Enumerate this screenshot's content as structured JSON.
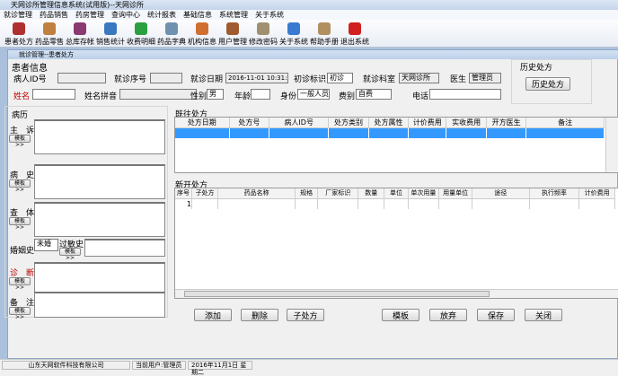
{
  "window": {
    "title": "天网诊所管理信息系统(试用版)--天网诊所"
  },
  "menu": [
    "就诊管理",
    "药品销售",
    "药房管理",
    "查询中心",
    "统计报表",
    "基础信息",
    "系统管理",
    "关于系统"
  ],
  "toolbar": [
    {
      "label": "患者处方",
      "icon": "patient-prescription-icon",
      "color": "#b03030"
    },
    {
      "label": "药品零售",
      "icon": "drug-retail-icon",
      "color": "#c08040"
    },
    {
      "label": "总库存帐",
      "icon": "inventory-icon",
      "color": "#8a3a70"
    },
    {
      "label": "销售统计",
      "icon": "sales-chart-icon",
      "color": "#3a78c0"
    },
    {
      "label": "收费明细",
      "icon": "dollar-icon",
      "color": "#2aa040"
    },
    {
      "label": "药品字典",
      "icon": "syringe-icon",
      "color": "#7090b0"
    },
    {
      "label": "机构信息",
      "icon": "house-icon",
      "color": "#d07030"
    },
    {
      "label": "用户管理",
      "icon": "user-icon",
      "color": "#a05a30"
    },
    {
      "label": "修改密码",
      "icon": "key-icon",
      "color": "#a09070"
    },
    {
      "label": "关于系统",
      "icon": "question-icon",
      "color": "#3a7ad0"
    },
    {
      "label": "帮助手册",
      "icon": "book-icon",
      "color": "#b09060"
    },
    {
      "label": "退出系统",
      "icon": "power-icon",
      "color": "#d02020"
    }
  ],
  "child": {
    "title": "就诊管理--患者处方"
  },
  "patient": {
    "group": "患者信息",
    "id_label": "病人ID号",
    "id_value": "",
    "seq_label": "就诊序号",
    "seq_value": "",
    "date_label": "就诊日期",
    "date_value": "2016-11-01 10:31:31",
    "visit_label": "初诊标识",
    "visit_value": "初诊",
    "dept_label": "就诊科室",
    "dept_value": "天网诊所",
    "doctor_label": "医生",
    "doctor_value": "管理员",
    "name_label": "姓名",
    "name_value": "",
    "pinyin_label": "姓名拼音",
    "pinyin_value": "",
    "sex_label": "性别",
    "sex_value": "男",
    "age_label": "年龄",
    "age_value": "",
    "identity_label": "身份",
    "identity_value": "一般人员",
    "fee_label": "费别",
    "fee_value": "自费",
    "phone_label": "电话",
    "phone_value": ""
  },
  "history": {
    "group": "历史处方",
    "button": "历史处方"
  },
  "record": {
    "group": "病历",
    "template": "模板>>",
    "complaint": "主　诉",
    "illness": "病　史",
    "exam": "查　体",
    "marriage": "婚姻史",
    "marriage_value": "未婚",
    "allergy": "过敏史",
    "diagnosis": "诊　断",
    "notes": "备　注"
  },
  "past": {
    "group": "既往处方",
    "columns": [
      "处方日期",
      "处方号",
      "病人ID号",
      "处方类别",
      "处方属性",
      "计价费用",
      "实收费用",
      "开方医生",
      "备注"
    ]
  },
  "new_rx": {
    "group": "新开处方",
    "columns": [
      "序号",
      "子处方",
      "药品名称",
      "规格",
      "厂家标识",
      "数量",
      "单位",
      "单次用量",
      "用量单位",
      "途径",
      "执行频率",
      "计价费用"
    ],
    "rows": [
      [
        "1",
        "",
        "",
        "",
        "",
        "",
        "",
        "",
        "",
        "",
        "",
        ""
      ]
    ]
  },
  "buttons": {
    "add": "添加",
    "delete": "删除",
    "sub": "子处方",
    "template": "模板",
    "discard": "放弃",
    "save": "保存",
    "close": "关闭"
  },
  "status": {
    "company": "山东天网软件科技有限公司",
    "user": "当前用户:管理员",
    "date": "2016年11月1日  星期二"
  }
}
